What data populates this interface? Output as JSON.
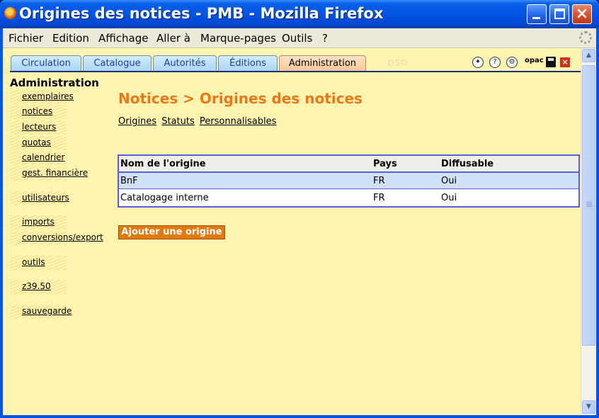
{
  "window": {
    "title": "Origines des notices - PMB - Mozilla Firefox"
  },
  "menu": {
    "items": [
      "Fichier",
      "Edition",
      "Affichage",
      "Aller à",
      "Marque-pages",
      "Outils",
      "?"
    ]
  },
  "tabs": {
    "items": [
      "Circulation",
      "Catalogue",
      "Autorités",
      "Éditions",
      "Administration"
    ],
    "active": "Administration",
    "ghost_label": "DSO",
    "toolbar_icons": [
      "compass-icon",
      "help-icon",
      "preferences-icon",
      "opac-icon",
      "save-icon",
      "close-icon"
    ],
    "opac_label": "opac",
    "close_glyph": "×",
    "help_glyph": "?"
  },
  "sidebar": {
    "title": "Administration",
    "items": [
      "exemplaires",
      "notices",
      "lecteurs",
      "quotas",
      "calendrier",
      "gest. financière",
      "utilisateurs",
      "imports",
      "conversions/export",
      "outils",
      "z39.50",
      "sauvegarde"
    ]
  },
  "main": {
    "title": "Notices > Origines des notices",
    "sublinks": [
      "Origines",
      "Statuts",
      "Personnalisables"
    ],
    "table": {
      "headers": [
        "Nom de l'origine",
        "Pays",
        "Diffusable"
      ],
      "rows": [
        [
          "BnF",
          "FR",
          "Oui"
        ],
        [
          "Catalogage interne",
          "FR",
          "Oui"
        ]
      ]
    },
    "add_button": "Ajouter une origine"
  },
  "colors": {
    "content_background": "#fff4b0",
    "title_orange": "#e87818",
    "button_orange": "#e07a10",
    "table_border": "#5b5fd6",
    "selected_row": "#cfe0f7"
  }
}
